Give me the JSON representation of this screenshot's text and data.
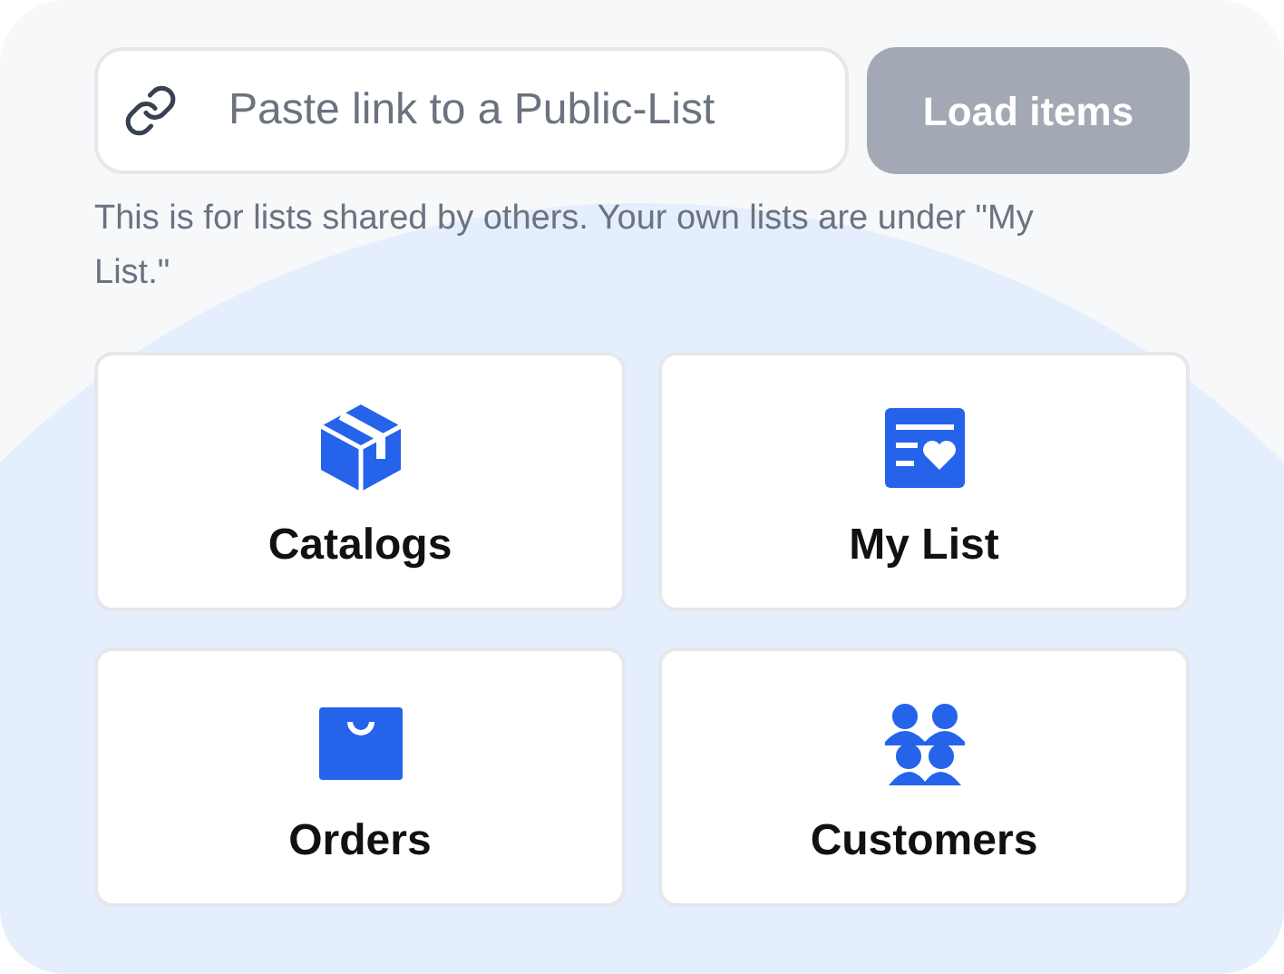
{
  "link_field": {
    "placeholder": "Paste link to a Public-List"
  },
  "load_button": {
    "label": "Load items",
    "disabled": true
  },
  "helper_text": "This is for lists shared by others. Your own lists are under \"My List.\"",
  "tiles": [
    {
      "label": "Catalogs"
    },
    {
      "label": "My List"
    },
    {
      "label": "Orders"
    },
    {
      "label": "Customers"
    }
  ]
}
